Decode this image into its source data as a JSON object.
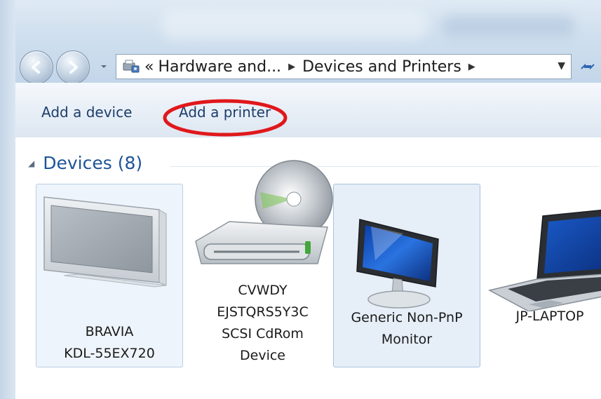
{
  "nav": {
    "back_icon": "back-arrow-icon",
    "forward_icon": "forward-arrow-icon"
  },
  "address": {
    "overflow": "«",
    "crumb1": "Hardware and...",
    "crumb2": "Devices and Printers"
  },
  "command_bar": {
    "add_device": "Add a device",
    "add_printer": "Add a printer"
  },
  "group": {
    "title": "Devices (8)"
  },
  "devices": [
    {
      "line1": "BRAVIA",
      "line2": "KDL-55EX720",
      "icon": "tv-icon"
    },
    {
      "line1": "CVWDY",
      "line2": "EJSTQRS5Y3C",
      "line3": "SCSI CdRom",
      "line4": "Device",
      "icon": "cdrom-drive-icon"
    },
    {
      "line1": "Generic Non-PnP",
      "line2": "Monitor",
      "icon": "monitor-icon"
    },
    {
      "line1": "JP-LAPTOP",
      "icon": "laptop-icon"
    }
  ],
  "colors": {
    "link": "#1c3d6b",
    "group_title": "#1e5499",
    "annotation": "#e0181c"
  }
}
